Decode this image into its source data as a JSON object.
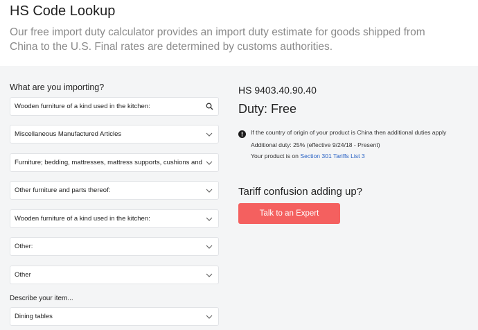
{
  "header": {
    "title": "HS Code Lookup",
    "subtitle": "Our free import duty calculator provides an import duty estimate for goods shipped from China to the U.S. Final rates are determined by customs authorities."
  },
  "form": {
    "importing_label": "What are you importing?",
    "search_value": "Wooden furniture of a kind used in the kitchen:",
    "selects": [
      "Miscellaneous Manufactured Articles",
      "Furniture; bedding, mattresses, mattress supports, cushions and similar stuffed",
      "Other furniture and parts thereof:",
      "Wooden furniture of a kind used in the kitchen:",
      "Other:",
      "Other"
    ],
    "describe_label": "Describe your item...",
    "describe_value": "Dining tables"
  },
  "result": {
    "hs_code": "HS 9403.40.90.40",
    "duty": "Duty: Free",
    "notice": "If the country of origin of your product is China then additional duties apply",
    "additional_duty": "Additional duty: 25% (effective 9/24/18 - Present)",
    "list_prefix": "Your product is on ",
    "list_link": "Section 301 Tariffs List 3",
    "confusion_heading": "Tariff confusion adding up?",
    "expert_button": "Talk to an Expert"
  },
  "colors": {
    "accent_button": "#f4605f",
    "link": "#2962c4",
    "panel_bg": "#f4f5f6"
  },
  "icons": [
    "search-icon",
    "chevron-down-icon",
    "info-icon"
  ]
}
